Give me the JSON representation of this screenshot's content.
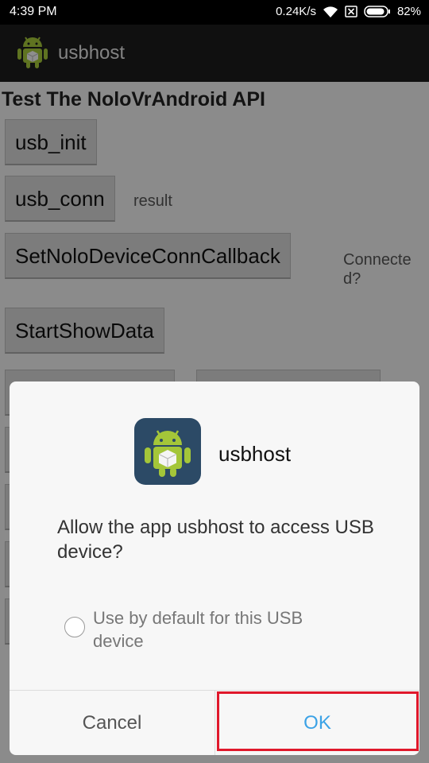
{
  "status_bar": {
    "time": "4:39  PM",
    "net_speed": "0.24K/s",
    "battery": "82%",
    "icons": [
      "wifi-icon",
      "sim-x-icon",
      "battery-icon"
    ]
  },
  "action_bar": {
    "title": "usbhost",
    "icon": "android-app-icon"
  },
  "content": {
    "heading": "Test The NoloVrAndroid API",
    "buttons": {
      "usb_init": "usb_init",
      "usb_conn": "usb_conn",
      "set_callback": "SetNoloDeviceConnCallback",
      "start_show": "StartShowData"
    },
    "result_label": "result",
    "connected_label": "Connected?"
  },
  "dialog": {
    "app_name": "usbhost",
    "message": "Allow the app usbhost to access USB device?",
    "default_checkbox_label": "Use by default for this USB device",
    "default_checked": false,
    "cancel_label": "Cancel",
    "ok_label": "OK"
  },
  "colors": {
    "ok_text": "#3ba2e6",
    "highlight_border": "#e0182b",
    "android_green": "#a4c639"
  }
}
